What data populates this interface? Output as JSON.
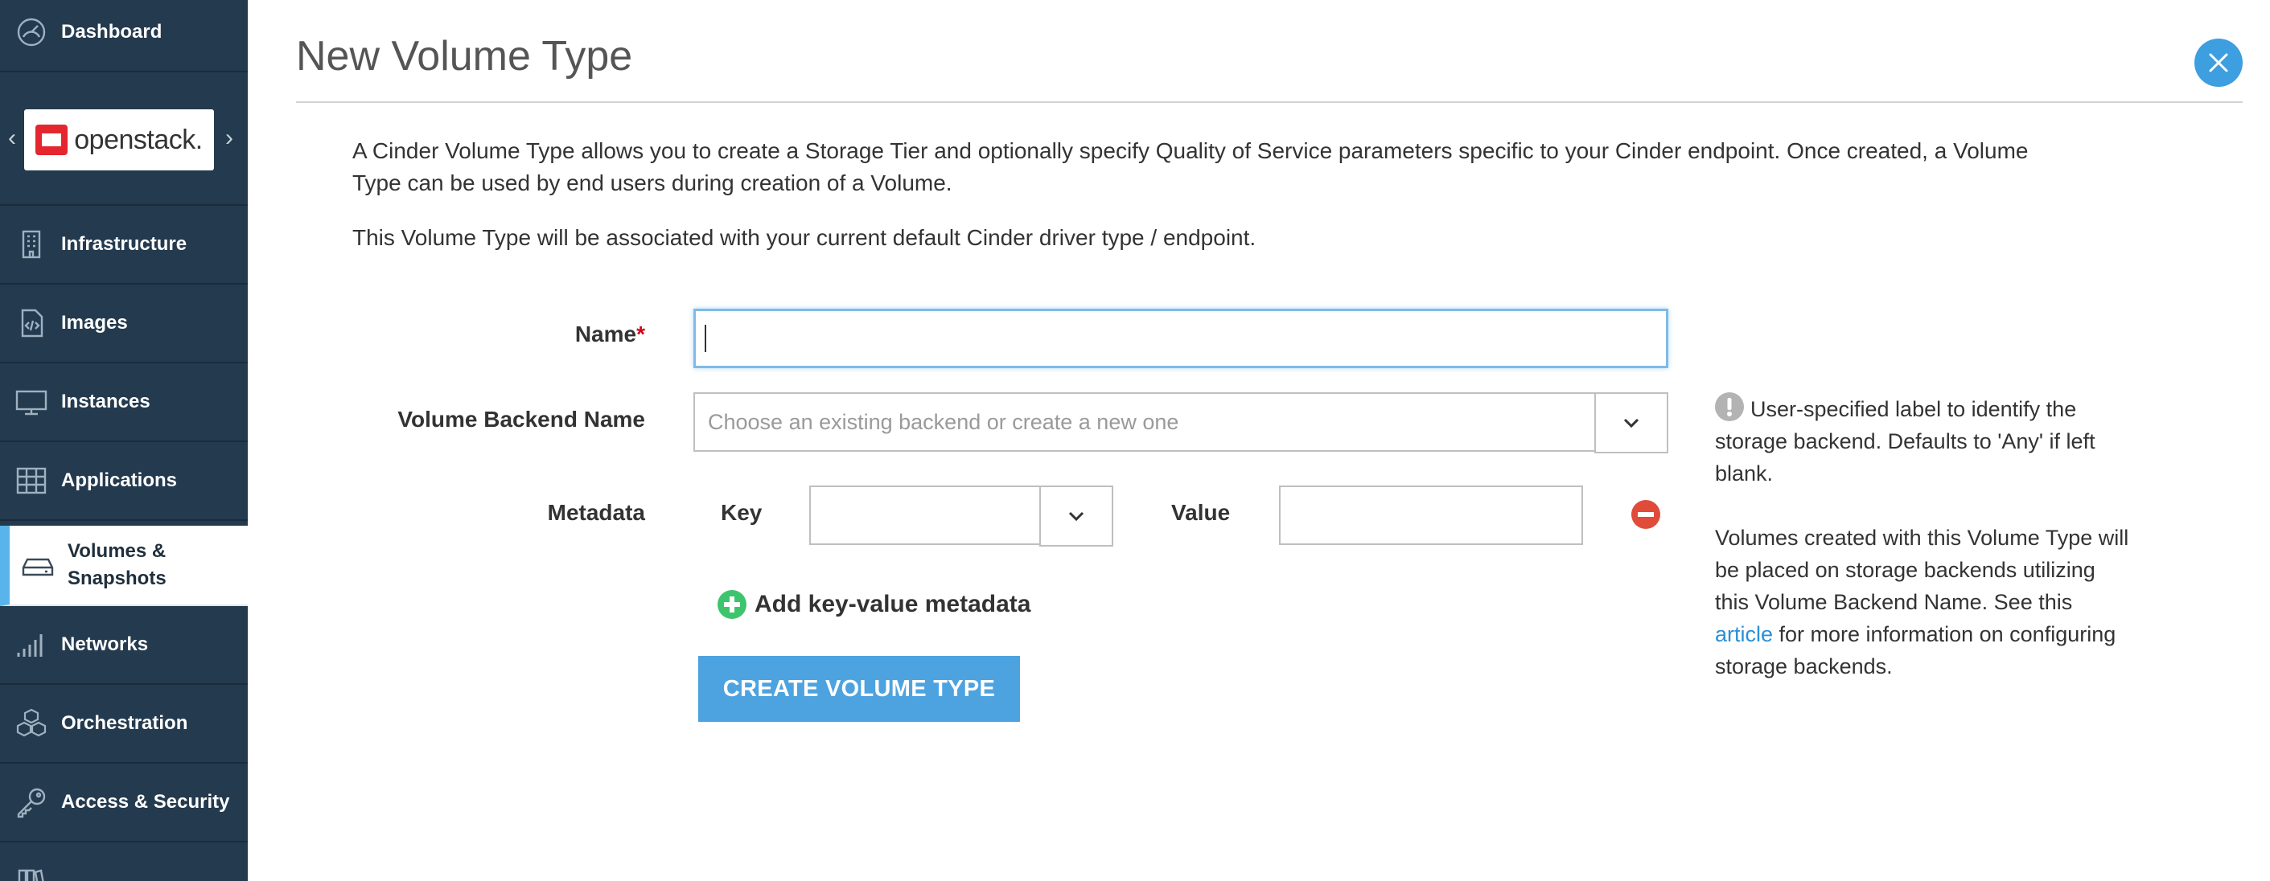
{
  "sidebar": {
    "dashboard": "Dashboard",
    "logo_text": "openstack.",
    "items": [
      {
        "label": "Infrastructure"
      },
      {
        "label": "Images"
      },
      {
        "label": "Instances"
      },
      {
        "label": "Applications"
      },
      {
        "label": "Volumes &",
        "label2": "Snapshots",
        "active": true
      },
      {
        "label": "Networks"
      },
      {
        "label": "Orchestration"
      },
      {
        "label": "Access & Security"
      }
    ]
  },
  "page": {
    "title": "New Volume Type",
    "intro_1": "A Cinder Volume Type allows you to create a Storage Tier and optionally specify Quality of Service parameters specific to your Cinder endpoint. Once created, a Volume Type can be used by end users during creation of a Volume.",
    "intro_2": "This Volume Type will be associated with your current default Cinder driver type / endpoint."
  },
  "form": {
    "name_label": "Name",
    "name_required": "*",
    "name_value": "",
    "backend_label": "Volume Backend Name",
    "backend_placeholder": "Choose an existing backend or create a new one",
    "metadata_label": "Metadata",
    "key_label": "Key",
    "value_label": "Value",
    "key_value": "",
    "value_value": "",
    "add_metadata": "Add key-value metadata",
    "submit": "CREATE VOLUME TYPE"
  },
  "help": {
    "p1": "User-specified label to identify the storage backend. Defaults to 'Any' if left blank.",
    "p2_before": "Volumes created with this Volume Type will be placed on storage backends utilizing this Volume Backend Name. See this ",
    "p2_link": "article",
    "p2_after": " for more information on configuring storage backends."
  },
  "colors": {
    "sidebar_bg": "#243a4e",
    "accent_blue": "#4da3e0",
    "active_indicator": "#58b4ea",
    "add_green": "#3ec46d",
    "remove_red": "#e04b3a",
    "required_red": "#d0021b"
  },
  "icons": {
    "dashboard": "gauge-icon",
    "infrastructure": "building-icon",
    "images": "code-file-icon",
    "instances": "monitor-icon",
    "applications": "grid-icon",
    "volumes": "hard-drive-icon",
    "networks": "signal-bars-icon",
    "orchestration": "cubes-icon",
    "access": "key-icon"
  }
}
